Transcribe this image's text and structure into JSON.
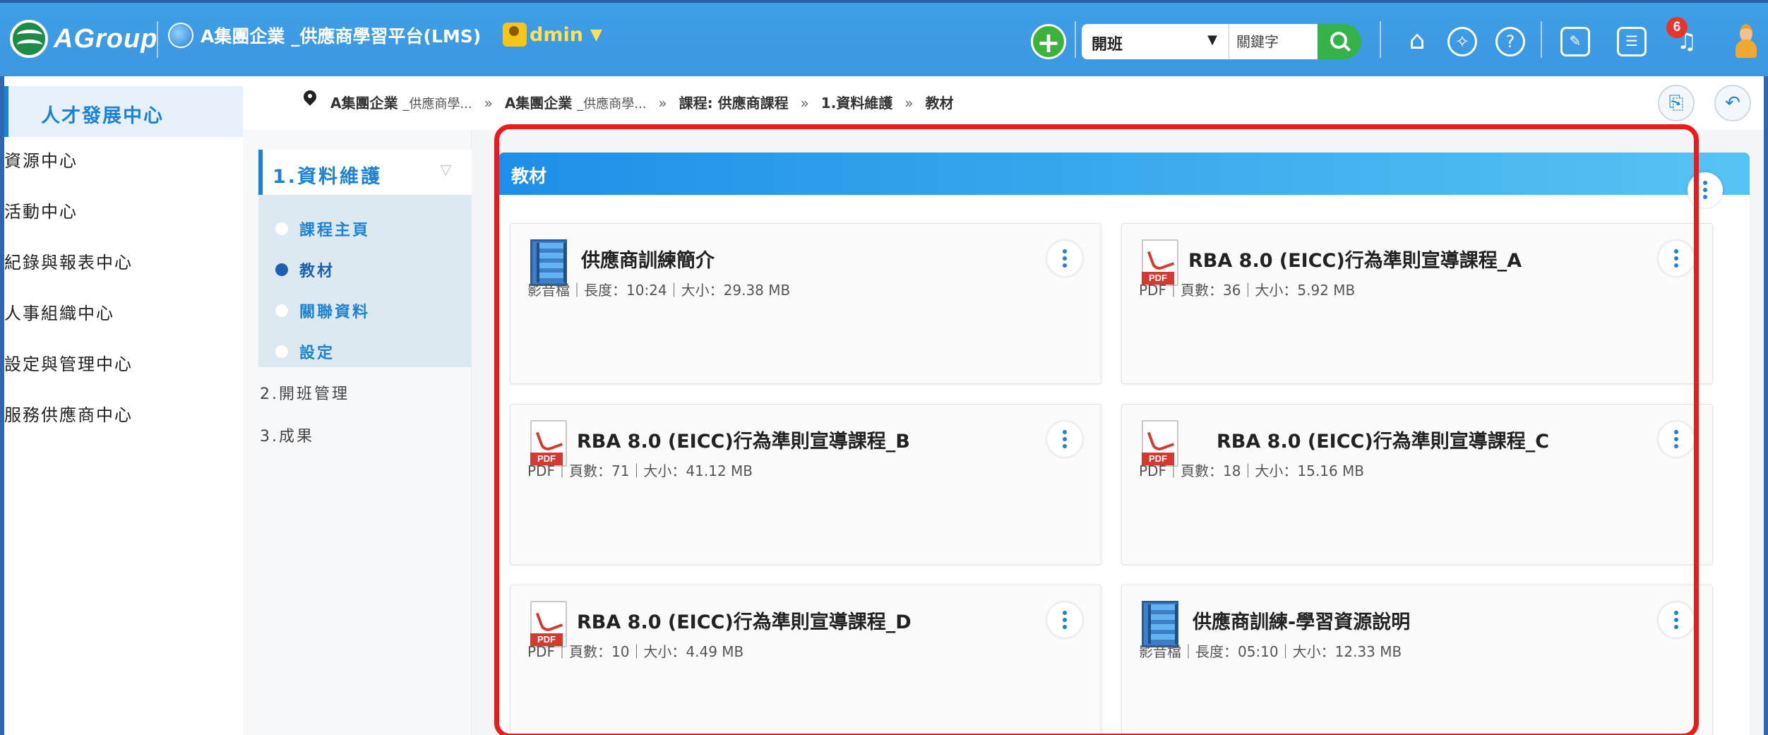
{
  "header": {
    "logo_text": "AGroup",
    "platform_title": "A集團企業 _供應商學習平台(LMS)",
    "admin_label": "dmin",
    "add_button": "+",
    "class_select": {
      "value": "開班",
      "options": [
        "開班"
      ]
    },
    "keyword": {
      "placeholder": "關鍵字"
    },
    "notification_count": "6",
    "icons": [
      "home-icon",
      "explore-icon",
      "help-icon",
      "report-icon",
      "list-icon",
      "bell-icon",
      "user-icon"
    ]
  },
  "leftnav": {
    "active": "人才發展中心",
    "items": [
      "資源中心",
      "活動中心",
      "紀錄與報表中心",
      "人事組織中心",
      "設定與管理中心",
      "服務供應商中心"
    ]
  },
  "breadcrumb": {
    "crumb1": "A集團企業",
    "crumb1_small": "_供應商學...",
    "crumb2": "A集團企業",
    "crumb2_small": "_供應商學...",
    "crumb3": "課程: 供應商課程",
    "crumb4": "1.資料維護",
    "crumb5": "教材"
  },
  "course_nav": {
    "section": "1.資料維護",
    "subitems": [
      "課程主頁",
      "教材",
      "關聯資料",
      "設定"
    ],
    "active_subitem": "教材",
    "others": [
      "2.開班管理",
      "3.成果"
    ]
  },
  "panel": {
    "title": "教材",
    "materials": [
      {
        "type": "video",
        "title": "供應商訓練簡介",
        "meta": "影音檔｜長度：10:24｜大小：29.38 MB"
      },
      {
        "type": "pdf",
        "title": "RBA 8.0 (EICC)行為準則宣導課程_A",
        "meta": "PDF｜頁數：36｜大小：5.92 MB"
      },
      {
        "type": "pdf",
        "title": "RBA 8.0 (EICC)行為準則宣導課程_B",
        "meta": "PDF｜頁數：71｜大小：41.12 MB"
      },
      {
        "type": "pdf",
        "title": "RBA 8.0 (EICC)行為準則宣導課程_C",
        "meta": "PDF｜頁數：18｜大小：15.16 MB"
      },
      {
        "type": "pdf",
        "title": "RBA 8.0 (EICC)行為準則宣導課程_D",
        "meta": "PDF｜頁數：10｜大小：4.49 MB"
      },
      {
        "type": "video",
        "title": "供應商訓練-學習資源說明",
        "meta": "影音檔｜長度：05:10｜大小：12.33 MB"
      }
    ]
  },
  "colors": {
    "topbar": "#3c98e0",
    "accent": "#1d82d6",
    "highlight": "#ee1a1a"
  }
}
